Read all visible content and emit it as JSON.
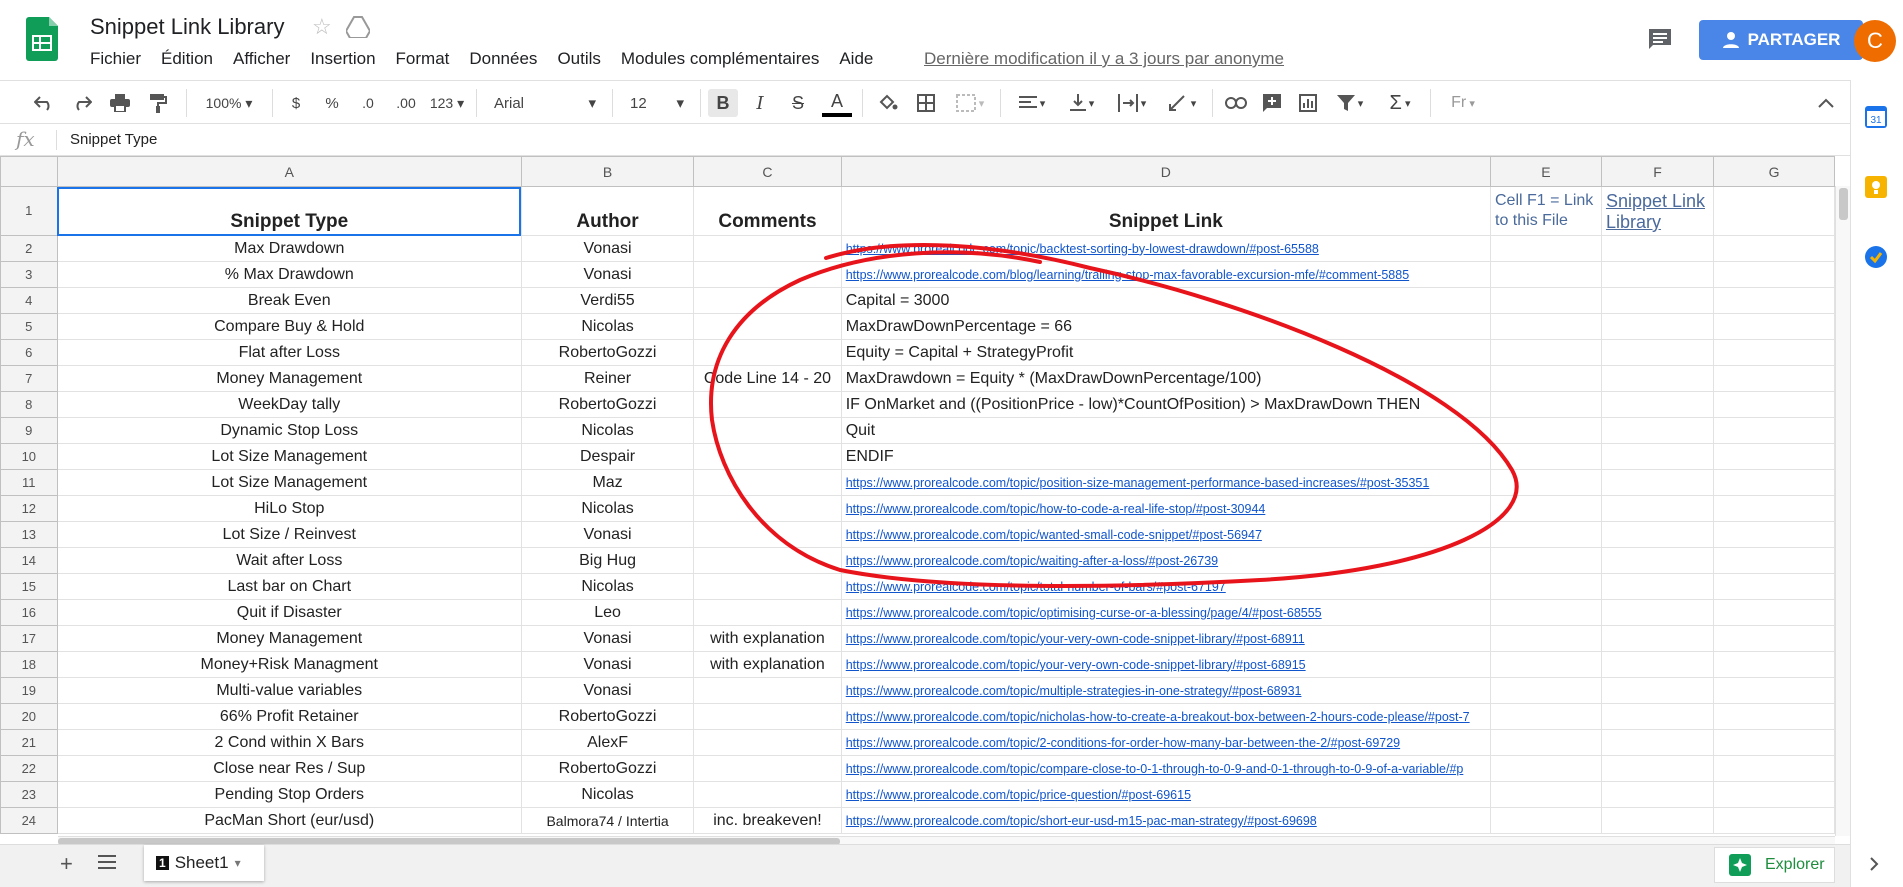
{
  "header": {
    "title": "Snippet Link Library",
    "menu": [
      "Fichier",
      "Édition",
      "Afficher",
      "Insertion",
      "Format",
      "Données",
      "Outils",
      "Modules complémentaires",
      "Aide"
    ],
    "last_modified": "Dernière modification il y a 3 jours par anonyme",
    "share_label": "PARTAGER",
    "avatar_letter": "C"
  },
  "toolbar": {
    "zoom": "100%",
    "currency": "$",
    "percent": "%",
    "dec_decrease": ".0",
    "dec_increase": ".00",
    "format_more": "123",
    "font": "Arial",
    "font_size": "12",
    "bold": "B",
    "italic": "I",
    "strike": "S",
    "text_color": "A",
    "input_tools": "Fr"
  },
  "formula": {
    "fx": "fx",
    "value": "Snippet Type"
  },
  "columns": [
    "A",
    "B",
    "C",
    "D",
    "E",
    "F",
    "G"
  ],
  "header_row": {
    "a": "Snippet Type",
    "b": "Author",
    "c": "Comments",
    "d": "Snippet Link",
    "e": "Cell F1 = Link to this File",
    "f": "Snippet Link Library"
  },
  "rows": [
    {
      "n": "2",
      "a": "Max Drawdown",
      "b": "Vonasi",
      "c": "",
      "d": "https://www.prorealcode.com/topic/backtest-sorting-by-lowest-drawdown/#post-65588",
      "link": true
    },
    {
      "n": "3",
      "a": "% Max Drawdown",
      "b": "Vonasi",
      "c": "",
      "d": "https://www.prorealcode.com/blog/learning/trailing-stop-max-favorable-excursion-mfe/#comment-5885",
      "link": true
    },
    {
      "n": "4",
      "a": "Break Even",
      "b": "Verdi55",
      "c": "",
      "d": "Capital = 3000",
      "link": false
    },
    {
      "n": "5",
      "a": "Compare Buy & Hold",
      "b": "Nicolas",
      "c": "",
      "d": "MaxDrawDownPercentage = 66",
      "link": false
    },
    {
      "n": "6",
      "a": "Flat after Loss",
      "b": "RobertoGozzi",
      "c": "",
      "d": "Equity = Capital + StrategyProfit",
      "link": false
    },
    {
      "n": "7",
      "a": "Money Management",
      "b": "Reiner",
      "c": "Code Line 14 - 20",
      "d": "MaxDrawdown = Equity * (MaxDrawDownPercentage/100)",
      "link": false
    },
    {
      "n": "8",
      "a": "WeekDay tally",
      "b": "RobertoGozzi",
      "c": "",
      "d": "IF OnMarket and ((PositionPrice - low)*CountOfPosition) > MaxDrawDown THEN",
      "link": false
    },
    {
      "n": "9",
      "a": "Dynamic Stop Loss",
      "b": "Nicolas",
      "c": "",
      "d": "Quit",
      "link": false
    },
    {
      "n": "10",
      "a": "Lot Size Management",
      "b": "Despair",
      "c": "",
      "d": "ENDIF",
      "link": false
    },
    {
      "n": "11",
      "a": "Lot Size Management",
      "b": "Maz",
      "c": "",
      "d": "https://www.prorealcode.com/topic/position-size-management-performance-based-increases/#post-35351",
      "link": true
    },
    {
      "n": "12",
      "a": "HiLo Stop",
      "b": "Nicolas",
      "c": "",
      "d": "https://www.prorealcode.com/topic/how-to-code-a-real-life-stop/#post-30944",
      "link": true
    },
    {
      "n": "13",
      "a": "Lot Size / Reinvest",
      "b": "Vonasi",
      "c": "",
      "d": "https://www.prorealcode.com/topic/wanted-small-code-snippet/#post-56947",
      "link": true
    },
    {
      "n": "14",
      "a": "Wait after Loss",
      "b": "Big Hug",
      "c": "",
      "d": "https://www.prorealcode.com/topic/waiting-after-a-loss/#post-26739",
      "link": true
    },
    {
      "n": "15",
      "a": "Last bar on Chart",
      "b": "Nicolas",
      "c": "",
      "d": "https://www.prorealcode.com/topic/total-number-of-bars/#post-67197",
      "link": true
    },
    {
      "n": "16",
      "a": "Quit if Disaster",
      "b": "Leo",
      "c": "",
      "d": "https://www.prorealcode.com/topic/optimising-curse-or-a-blessing/page/4/#post-68555",
      "link": true
    },
    {
      "n": "17",
      "a": "Money Management",
      "b": "Vonasi",
      "c": "with explanation",
      "d": "https://www.prorealcode.com/topic/your-very-own-code-snippet-library/#post-68911",
      "link": true
    },
    {
      "n": "18",
      "a": "Money+Risk Managment",
      "b": "Vonasi",
      "c": "with explanation",
      "d": "https://www.prorealcode.com/topic/your-very-own-code-snippet-library/#post-68915",
      "link": true
    },
    {
      "n": "19",
      "a": "Multi-value variables",
      "b": "Vonasi",
      "c": "",
      "d": "https://www.prorealcode.com/topic/multiple-strategies-in-one-strategy/#post-68931",
      "link": true
    },
    {
      "n": "20",
      "a": "66% Profit Retainer",
      "b": "RobertoGozzi",
      "c": "",
      "d": "https://www.prorealcode.com/topic/nicholas-how-to-create-a-breakout-box-between-2-hours-code-please/#post-7",
      "link": true
    },
    {
      "n": "21",
      "a": "2 Cond within X Bars",
      "b": "AlexF",
      "c": "",
      "d": "https://www.prorealcode.com/topic/2-conditions-for-order-how-many-bar-between-the-2/#post-69729",
      "link": true
    },
    {
      "n": "22",
      "a": "Close near Res / Sup",
      "b": "RobertoGozzi",
      "c": "",
      "d": "https://www.prorealcode.com/topic/compare-close-to-0-1-through-to-0-9-and-0-1-through-to-0-9-of-a-variable/#p",
      "link": true
    },
    {
      "n": "23",
      "a": "Pending Stop Orders",
      "b": "Nicolas",
      "c": "",
      "d": "https://www.prorealcode.com/topic/price-question/#post-69615",
      "link": true
    },
    {
      "n": "24",
      "a": "PacMan Short (eur/usd)",
      "b": "Balmora74 / Intertia",
      "c": "inc. breakeven!",
      "d": "https://www.prorealcode.com/topic/short-eur-usd-m15-pac-man-strategy/#post-69698",
      "link": true
    }
  ],
  "bottom": {
    "sheet_name": "Sheet1",
    "sheet_number": "1",
    "explore_label": "Explorer"
  },
  "colors": {
    "accent": "#4a86e8",
    "avatar": "#ef6c00",
    "sheets_green": "#0f9d58",
    "link": "#1155cc",
    "annotation": "#e8141b"
  },
  "icons": [
    "sheets-logo-icon",
    "star-icon",
    "drive-move-icon",
    "comment-icon",
    "share-person-icon",
    "undo-icon",
    "redo-icon",
    "print-icon",
    "paint-format-icon",
    "fill-color-icon",
    "borders-icon",
    "merge-icon",
    "align-left-icon",
    "valign-bottom-icon",
    "wrap-icon",
    "rotate-icon",
    "link-icon",
    "insert-comment-icon",
    "insert-chart-icon",
    "filter-icon",
    "functions-icon",
    "collapse-icon",
    "add-sheet-icon",
    "all-sheets-icon",
    "calendar-icon",
    "keep-icon",
    "tasks-icon"
  ]
}
